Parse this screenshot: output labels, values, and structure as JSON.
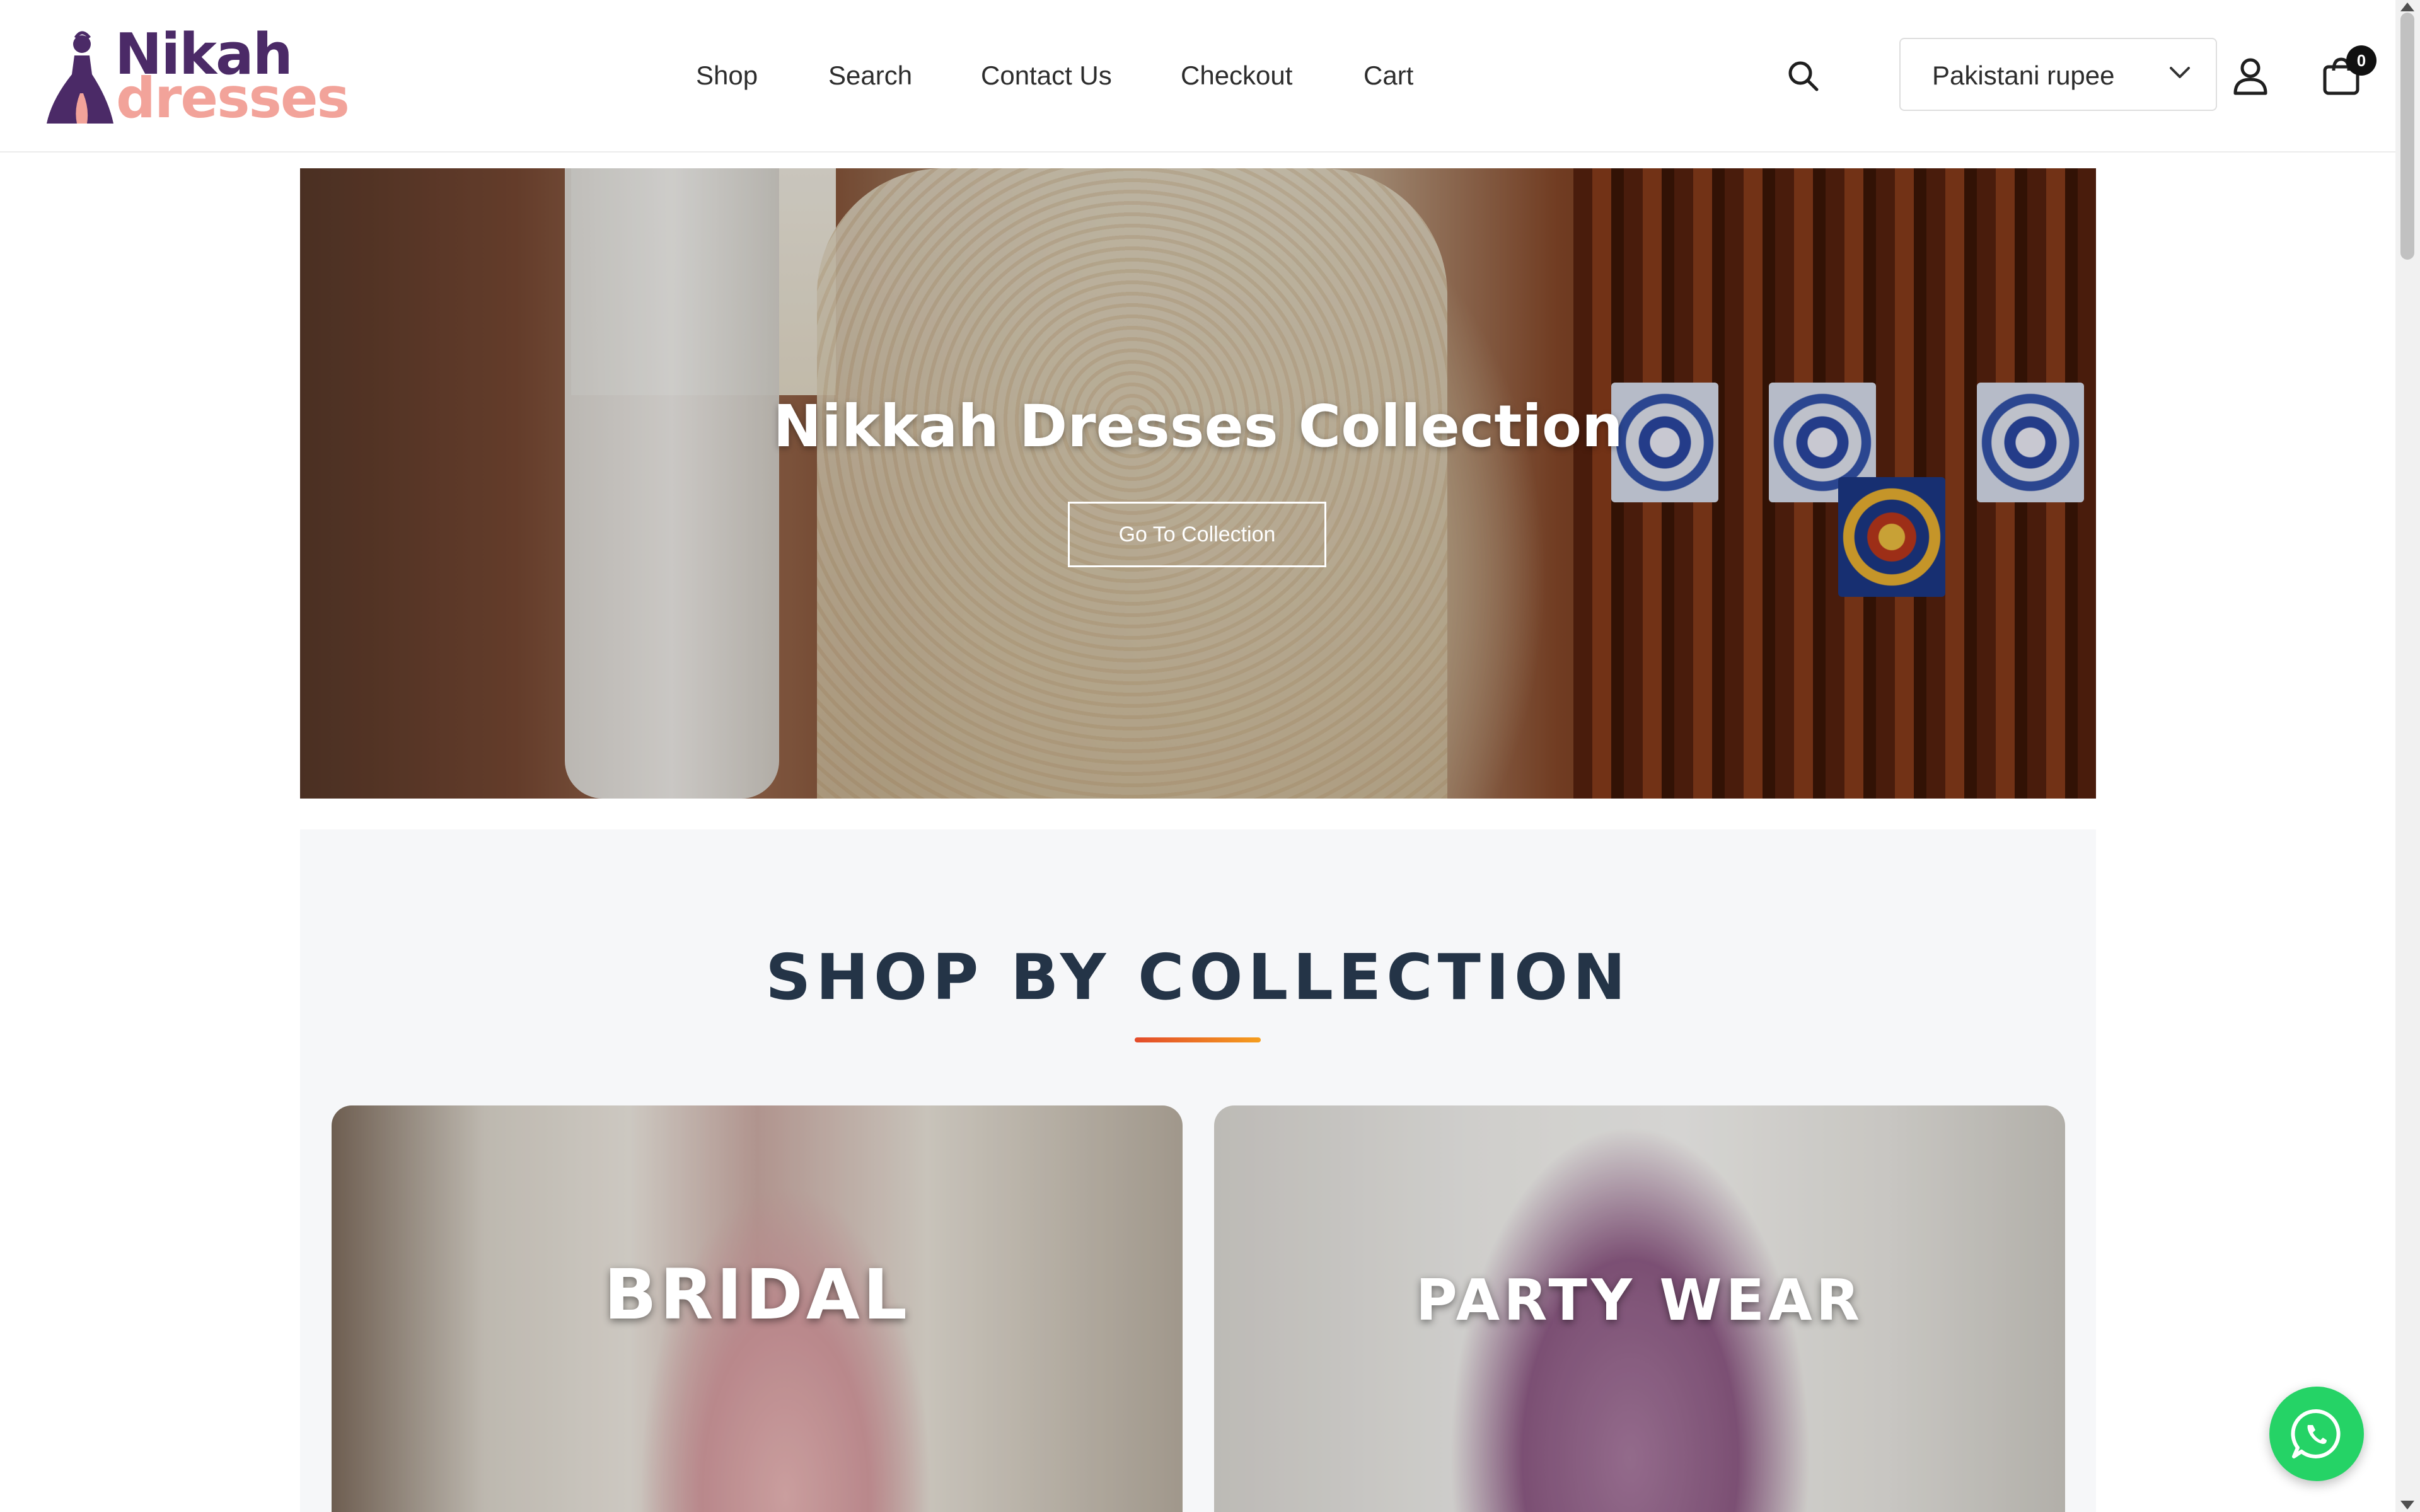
{
  "brand": {
    "word1": "Nikah",
    "word2": "dresses",
    "colors": {
      "primary": "#4b2a67",
      "accent": "#f2a39a"
    }
  },
  "nav": {
    "items": [
      "Shop",
      "Search",
      "Contact Us",
      "Checkout",
      "Cart"
    ]
  },
  "header": {
    "search_icon": "search-icon",
    "currency": {
      "selected": "Pakistani rupee"
    },
    "account_icon": "user-icon",
    "cart": {
      "icon": "shopping-bag-icon",
      "count": "0"
    }
  },
  "hero": {
    "title": "Nikkah Dresses Collection",
    "button_label": "Go To Collection"
  },
  "collection_section": {
    "title": "SHOP BY COLLECTION",
    "accent_gradient": [
      "#e34b2b",
      "#f59e1e"
    ],
    "cards": [
      {
        "label": "BRIDAL"
      },
      {
        "label": "PARTY WEAR"
      }
    ]
  },
  "floating": {
    "whatsapp_icon": "whatsapp-icon",
    "color": "#25d366"
  }
}
